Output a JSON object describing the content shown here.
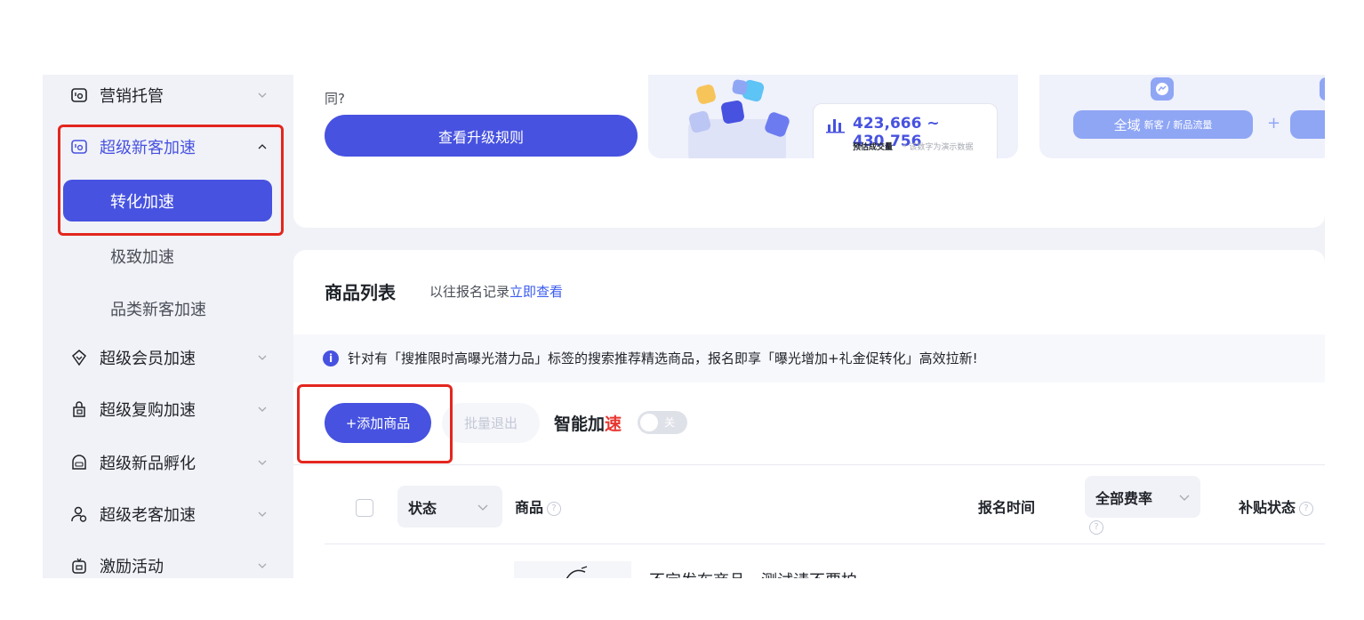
{
  "sidebar": {
    "items": [
      {
        "label": "营销托管",
        "icon": "tag-icon"
      },
      {
        "label": "超级新客加速",
        "icon": "tag-icon"
      },
      {
        "label": "超级会员加速",
        "icon": "diamond-icon"
      },
      {
        "label": "超级复购加速",
        "icon": "bag-icon"
      },
      {
        "label": "超级新品孵化",
        "icon": "new-badge-icon"
      },
      {
        "label": "超级老客加速",
        "icon": "users-icon"
      },
      {
        "label": "激励活动",
        "icon": "gift-icon"
      }
    ],
    "sub_items": [
      {
        "label": "转化加速",
        "active": true
      },
      {
        "label": "极致加速"
      },
      {
        "label": "品类新客加速"
      }
    ]
  },
  "top": {
    "partial_text": "同?",
    "upgrade_button": "查看升级规则",
    "stat_value": "423,666 ~ 430,756",
    "stat_label": "预估成交量",
    "stat_note": "* 该数字为演示数据",
    "traffic_tag_main": "全域",
    "traffic_tag_sub": "新客 / 新品流量",
    "plus": "+"
  },
  "products": {
    "title": "商品列表",
    "history_prefix": "以往报名记录",
    "history_link": "立即查看",
    "info_icon": "i",
    "info_text": "针对有「搜推限时高曝光潜力品」标签的搜索推荐精选商品，报名即享「曝光增加+礼金促转化」高效拉新!",
    "add_button": "+添加商品",
    "batch_exit_button": "批量退出",
    "smart_label_a": "智能加",
    "smart_label_b": "速",
    "toggle_label": "关",
    "columns": {
      "status": "状态",
      "product": "商品",
      "signup_time": "报名时间",
      "rate": "全部费率",
      "subsidy": "补贴状态",
      "help": "?"
    },
    "first_row_text": "不定发布商品，测试请不要拍"
  },
  "colors": {
    "primary": "#4752e0",
    "highlight_red": "#e3261f",
    "link": "#3a5bf0",
    "tag": "#8fa6f5"
  }
}
